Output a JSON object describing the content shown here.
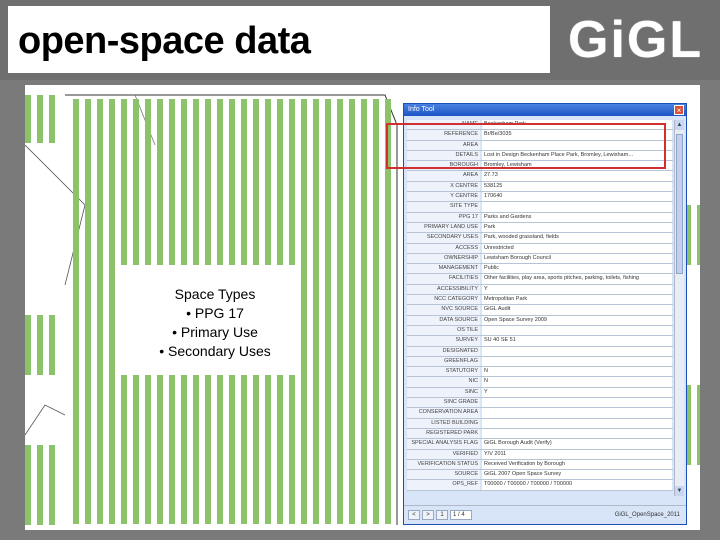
{
  "slide": {
    "title": "open-space data",
    "logo": "GiGL",
    "caption": {
      "heading": "Space Types",
      "bullets": [
        "• PPG 17",
        "• Primary Use",
        "• Secondary Uses"
      ]
    }
  },
  "info_window": {
    "title": "Info Tool",
    "close_label": "×",
    "rows": [
      {
        "label": "NAME",
        "value": "Beckenham Park"
      },
      {
        "label": "REFERENCE",
        "value": "Br/Be/3035"
      },
      {
        "label": "AREA",
        "value": ""
      },
      {
        "label": "DETAILS",
        "value": "Lost in Design Beckenham Place Park, Bromley, Lewisham…"
      },
      {
        "label": "BOROUGH",
        "value": "Bromley, Lewisham"
      },
      {
        "label": "AREA",
        "value": "27.73"
      },
      {
        "label": "X CENTRE",
        "value": "538125"
      },
      {
        "label": "Y CENTRE",
        "value": "170640"
      },
      {
        "label": "SITE TYPE",
        "value": ""
      },
      {
        "label": "PPG 17",
        "value": "Parks and Gardens"
      },
      {
        "label": "PRIMARY LAND USE",
        "value": "Park"
      },
      {
        "label": "SECONDARY USES",
        "value": "Park, wooded grassland, fields"
      },
      {
        "label": "ACCESS",
        "value": "Unrestricted"
      },
      {
        "label": "OWNERSHIP",
        "value": "Lewisham Borough Council"
      },
      {
        "label": "MANAGEMENT",
        "value": "Public"
      },
      {
        "label": "FACILITIES",
        "value": "Other facilities, play area, sports pitches, parking, toilets, fishing"
      },
      {
        "label": "ACCESSIBILITY",
        "value": "Y"
      },
      {
        "label": "NCC CATEGORY",
        "value": "Metropolitan Park"
      },
      {
        "label": "NVC SOURCE",
        "value": "GiGL Audit"
      },
      {
        "label": "DATA SOURCE",
        "value": "Open Space Survey 2009"
      },
      {
        "label": "OS TILE",
        "value": ""
      },
      {
        "label": "SURVEY",
        "value": "SU 40 SE 51"
      },
      {
        "label": "DESIGNATED",
        "value": ""
      },
      {
        "label": "GREENFLAG",
        "value": ""
      },
      {
        "label": "STATUTORY",
        "value": "N"
      },
      {
        "label": "NIC",
        "value": "N"
      },
      {
        "label": "SINC",
        "value": "Y"
      },
      {
        "label": "SINC GRADE",
        "value": ""
      },
      {
        "label": "CONSERVATION AREA",
        "value": ""
      },
      {
        "label": "LISTED BUILDING",
        "value": ""
      },
      {
        "label": "REGISTERED PARK",
        "value": ""
      },
      {
        "label": "SPECIAL ANALYSIS FLAG",
        "value": "GiGL Borough Audit (Verify)"
      },
      {
        "label": "VERIFIED",
        "value": "Y/V 2011"
      },
      {
        "label": "VERIFICATION STATUS",
        "value": "Received Verification by Borough"
      },
      {
        "label": "SOURCE",
        "value": "GiGL 2007 Open Space Survey"
      },
      {
        "label": "OPS_REF",
        "value": "T00000 / T00000 / T00000 / T00000"
      }
    ],
    "footer": {
      "nav": [
        "<",
        ">",
        "1"
      ],
      "record": "1 / 4",
      "layer": "GiGL_OpenSpace_2011"
    }
  },
  "colors": {
    "accent": "#1d55c7",
    "highlight": "#d03030",
    "hatch": "#8cc26a"
  }
}
